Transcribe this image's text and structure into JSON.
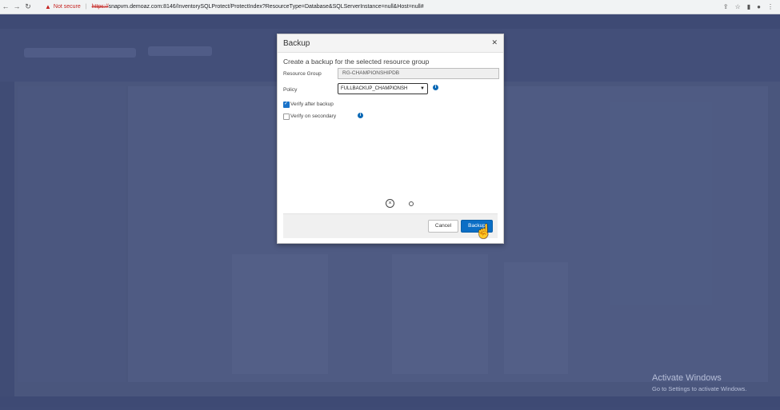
{
  "browser": {
    "security": "Not secure",
    "url_scheme": "https://",
    "url_rest": "snapvm.demoaz.com:8146/InventorySQLProtect/ProtectIndex?ResourceType=Database&SQLServerInstance=null&Host=null#"
  },
  "dialog": {
    "title": "Backup",
    "subtitle": "Create a backup for the selected resource group",
    "resource_group_label": "Resource Group",
    "resource_group_value": "RG-CHAMPIONSHIPDB",
    "policy_label": "Policy",
    "policy_value": "FULLBACKUP_CHAMPIONSH",
    "verify_after_backup": "Verify after backup",
    "verify_on_secondary": "Verify on secondary",
    "cancel_label": "Cancel",
    "backup_label": "Backup"
  },
  "watermark": {
    "title": "Activate Windows",
    "subtitle": "Go to Settings to activate Windows."
  },
  "colors": {
    "primary_button": "#0b6ec5",
    "info_icon": "#0a68b5"
  }
}
